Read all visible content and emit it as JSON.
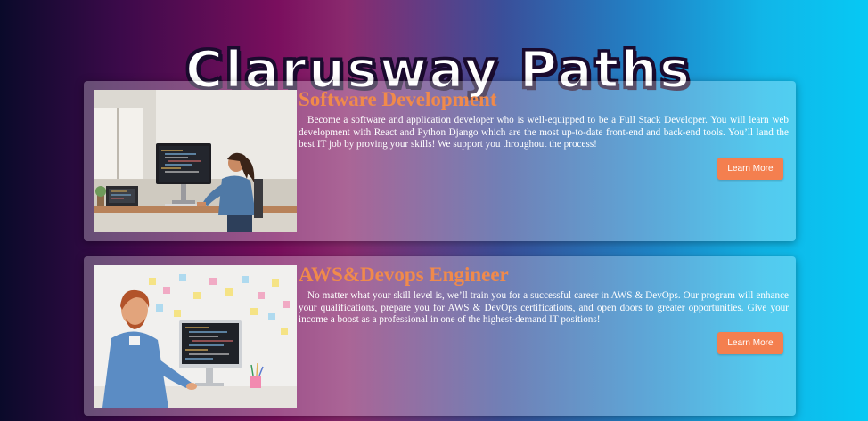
{
  "page": {
    "title": "Clarusway Paths"
  },
  "cards": [
    {
      "title": "Software Development",
      "description": "Become a software and application developer who is well-equipped to be a Full Stack Developer. You will learn web development with React and Python Django which are the most up-to-date front-end and back-end tools. You’ll land the best IT job by proving your skills! We support you throughout the process!",
      "button_label": "Learn More"
    },
    {
      "title": "AWS&Devops Engineer",
      "description": "No matter what your skill level is, we’ll train you for a successful career in AWS & DevOps. Our program will enhance your qualifications, prepare you for AWS & DevOps certifications, and open doors to greater opportunities. Give your income a boost as a professional in one of the highest-demand IT positions!",
      "button_label": "Learn More"
    }
  ],
  "colors": {
    "accent": "#f08a4b",
    "button": "#f47f4f"
  }
}
